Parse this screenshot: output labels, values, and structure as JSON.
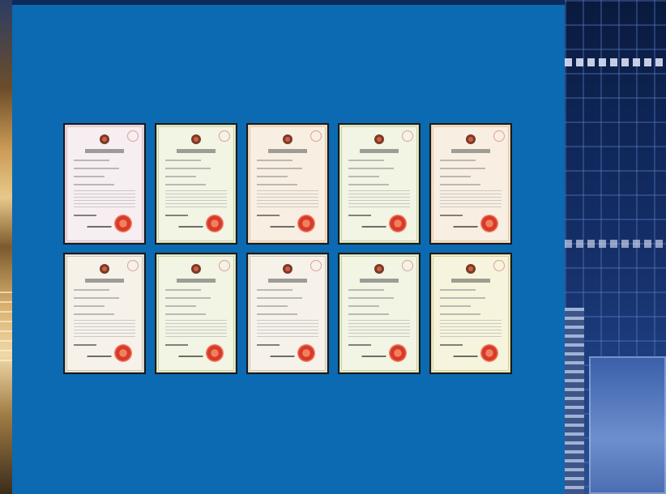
{
  "colors": {
    "panel": "#0b6ab2",
    "seal": "#d83a2a"
  },
  "certificates": [
    {
      "tone": "pink"
    },
    {
      "tone": "green"
    },
    {
      "tone": "orange"
    },
    {
      "tone": "green"
    },
    {
      "tone": "orange"
    },
    {
      "tone": "white"
    },
    {
      "tone": "green"
    },
    {
      "tone": "white"
    },
    {
      "tone": "green"
    },
    {
      "tone": "yellow"
    }
  ]
}
